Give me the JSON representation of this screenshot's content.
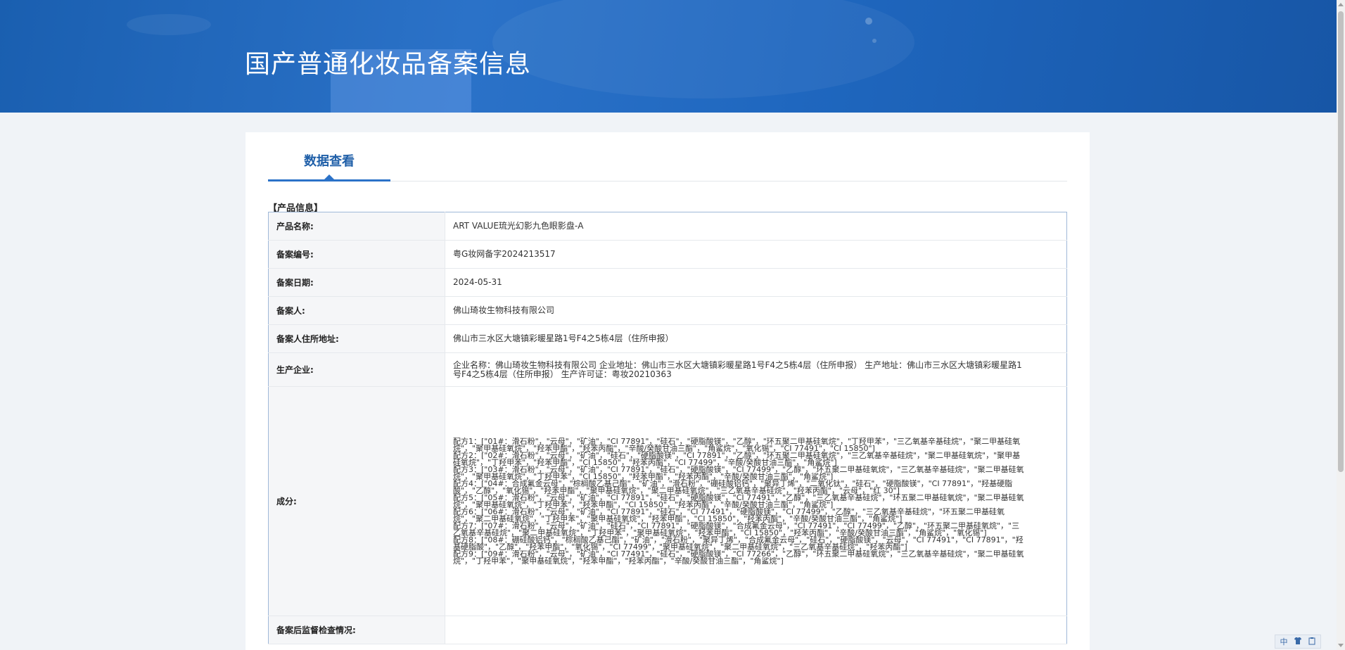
{
  "header": {
    "title": "国产普通化妆品备案信息"
  },
  "tabs": [
    {
      "label": "数据查看"
    }
  ],
  "section": {
    "title": "【产品信息】"
  },
  "rows": [
    {
      "label": "产品名称:",
      "value": "ART VALUE琉光幻影九色眼影盘-A"
    },
    {
      "label": "备案编号:",
      "value": "粤G妆网备字2024213517"
    },
    {
      "label": "备案日期:",
      "value": "2024-05-31"
    },
    {
      "label": "备案人:",
      "value": "佛山琦妆生物科技有限公司"
    },
    {
      "label": "备案人住所地址:",
      "value": "佛山市三水区大塘镇彩暖星路1号F4之5栋4层（住所申报）"
    },
    {
      "label": "生产企业:",
      "value": "企业名称：佛山琦妆生物科技有限公司 企业地址：佛山市三水区大塘镇彩暖星路1号F4之5栋4层（住所申报） 生产地址：佛山市三水区大塘镇彩暖星路1号F4之5栋4层（住所申报） 生产许可证：粤妆20210363"
    },
    {
      "label": "成分:",
      "formulas": [
        "配方1：[\"01#：滑石粉\"，\"云母\"，\"矿油\"，\"CI 77891\"，\"硅石\"，\"硬脂酸镁\"，\"乙醇\"，\"环五聚二甲基硅氧烷\"，\"丁羟甲苯\"，\"三乙氧基辛基硅烷\"，\"聚二甲基硅氧烷\"，\"聚甲基硅氧烷\"，\"羟苯甲酯\"，\"羟苯丙酯\"，\"辛酸/癸酸甘油三酯\"，\"角鲨烷\"，\"氧化锡\"，\"CI 77491\"，\"CI 15850\"]",
        "配方2：[\"02#：滑石粉\"，\"云母\"，\"矿油\"，\"硅石\"，\"硬脂酸镁\"，\"CI 77891\"，\"乙醇\"，\"环五聚二甲基硅氧烷\"，\"三乙氧基辛基硅烷\"，\"聚二甲基硅氧烷\"，\"聚甲基硅氧烷\"，\"丁羟甲苯\"，\"羟苯甲酯\"，\"CI 15850\"，\"羟苯丙酯\"，\"CI 77499\"，\"辛酸/癸酸甘油三酯\"，\"角鲨烷\"]",
        "配方3：[\"03#：滑石粉\"，\"云母\"，\"矿油\"，\"CI 77891\"，\"硅石\"，\"硬脂酸镁\"，\"CI 77499\"，\"乙醇\"，\"环五聚二甲基硅氧烷\"，\"三乙氧基辛基硅烷\"，\"聚二甲基硅氧烷\"，\"聚甲基硅氧烷\"，\"丁羟甲苯\"，\"CI 15850\"，\"羟苯甲酯\"，\"羟苯丙酯\"，\"辛酸/癸酸甘油三酯\"，\"角鲨烷\"]",
        "配方4：[\"04#：合成氟金云母\"，\"棕榈酸乙基己酯\"，\"矿油\"，\"滑石粉\"，\"硼硅酸铝钙\"，\"聚异丁烯\"，\"二氧化钛\"，\"硅石\"，\"硬脂酸镁\"，\"CI 77891\"，\"羟基硬脂酸\"，\"乙醇\"，\"氧化锡\"，\"羟苯甲酯\"，\"聚甲基硅氧烷\"，\"聚二甲基硅氧烷\"，\"三乙氧基辛基硅烷\"，\"羟苯丙酯\"，\"云母\"，\"红 30\"]",
        "配方5：[\"05#：滑石粉\"，\"云母\"，\"矿油\"，\"CI 77891\"，\"硅石\"，\"硬脂酸镁\"，\"CI 77491\"，\"乙醇\"，\"三乙氧基辛基硅烷\"，\"环五聚二甲基硅氧烷\"，\"聚二甲基硅氧烷\"，\"聚甲基硅氧烷\"，\"丁羟甲苯\"，\"羟苯甲酯\"，\"CI 15850\"，\"羟苯丙酯\"，\"辛酸/癸酸甘油三酯\"，\"角鲨烷\"]",
        "配方6：[\"06#：滑石粉\"，\"云母\"，\"矿油\"，\"CI 77891\"，\"硅石\"，\"CI 77491\"，\"硬脂酸镁\"，\"CI 77499\"，\"乙醇\"，\"三乙氧基辛基硅烷\"，\"环五聚二甲基硅氧烷\"，\"聚二甲基硅氧烷\"，\"丁羟甲苯\"，\"聚甲基硅氧烷\"，\"羟苯甲酯\"，\"CI 15850\"，\"羟苯丙酯\"，\"辛酸/癸酸甘油三酯\"，\"角鲨烷\"]",
        "配方7：[\"07#：滑石粉\"，\"云母\"，\"矿油\"，\"硅石\"，\"CI 77891\"，\"硬脂酸镁\"，\"合成氟金云母\"，\"CI 77491\"，\"CI 77499\"，\"乙醇\"，\"环五聚二甲基硅氧烷\"，\"三乙氧基辛基硅烷\"，\"聚二甲基硅氧烷\"，\"丁羟甲苯\"，\"聚甲基硅氧烷\"，\"羟苯甲酯\"，\"CI 15850\"，\"羟苯丙酯\"，\"辛酸/癸酸甘油三酯\"，\"角鲨烷\"，\"氧化锡\"]",
        "配方8：[\"08#：硼硅酸铝钙\"，\"棕榈酸乙基己酯\"，\"矿油\"，\"滑石粉\"，\"聚异丁烯\"，\"合成氟金云母\"，\"硅石\"，\"硬脂酸镁\"，\"云母\"，\"CI 77491\"，\"CI 77891\"，\"羟基硬脂酸\"，\"乙醇\"，\"羟苯甲酯\"，\"氧化锡\"，\"CI 77499\"，\"聚甲基硅氧烷\"，\"聚二甲基硅氧烷\"，\"三乙氧基辛基硅烷\"，\"羟苯丙酯\"]",
        "配方9：[\"09#：滑石粉\"，\"云母\"，\"矿油\"，\"CI 77491\"，\"硅石\"，\"硬脂酸镁\"，\"CI 77266\"，\"乙醇\"，\"环五聚二甲基硅氧烷\"，\"三乙氧基辛基硅烷\"，\"聚二甲基硅氧烷\"，\"丁羟甲苯\"，\"聚甲基硅氧烷\"，\"羟苯甲酯\"，\"羟苯丙酯\"，\"辛酸/癸酸甘油三酯\"，\"角鲨烷\"]"
      ]
    },
    {
      "label": "备案后监督检查情况:",
      "value": ""
    }
  ],
  "ime": {
    "lang": "中",
    "icon1": "shirt-icon",
    "icon2": "clipboard-icon"
  }
}
